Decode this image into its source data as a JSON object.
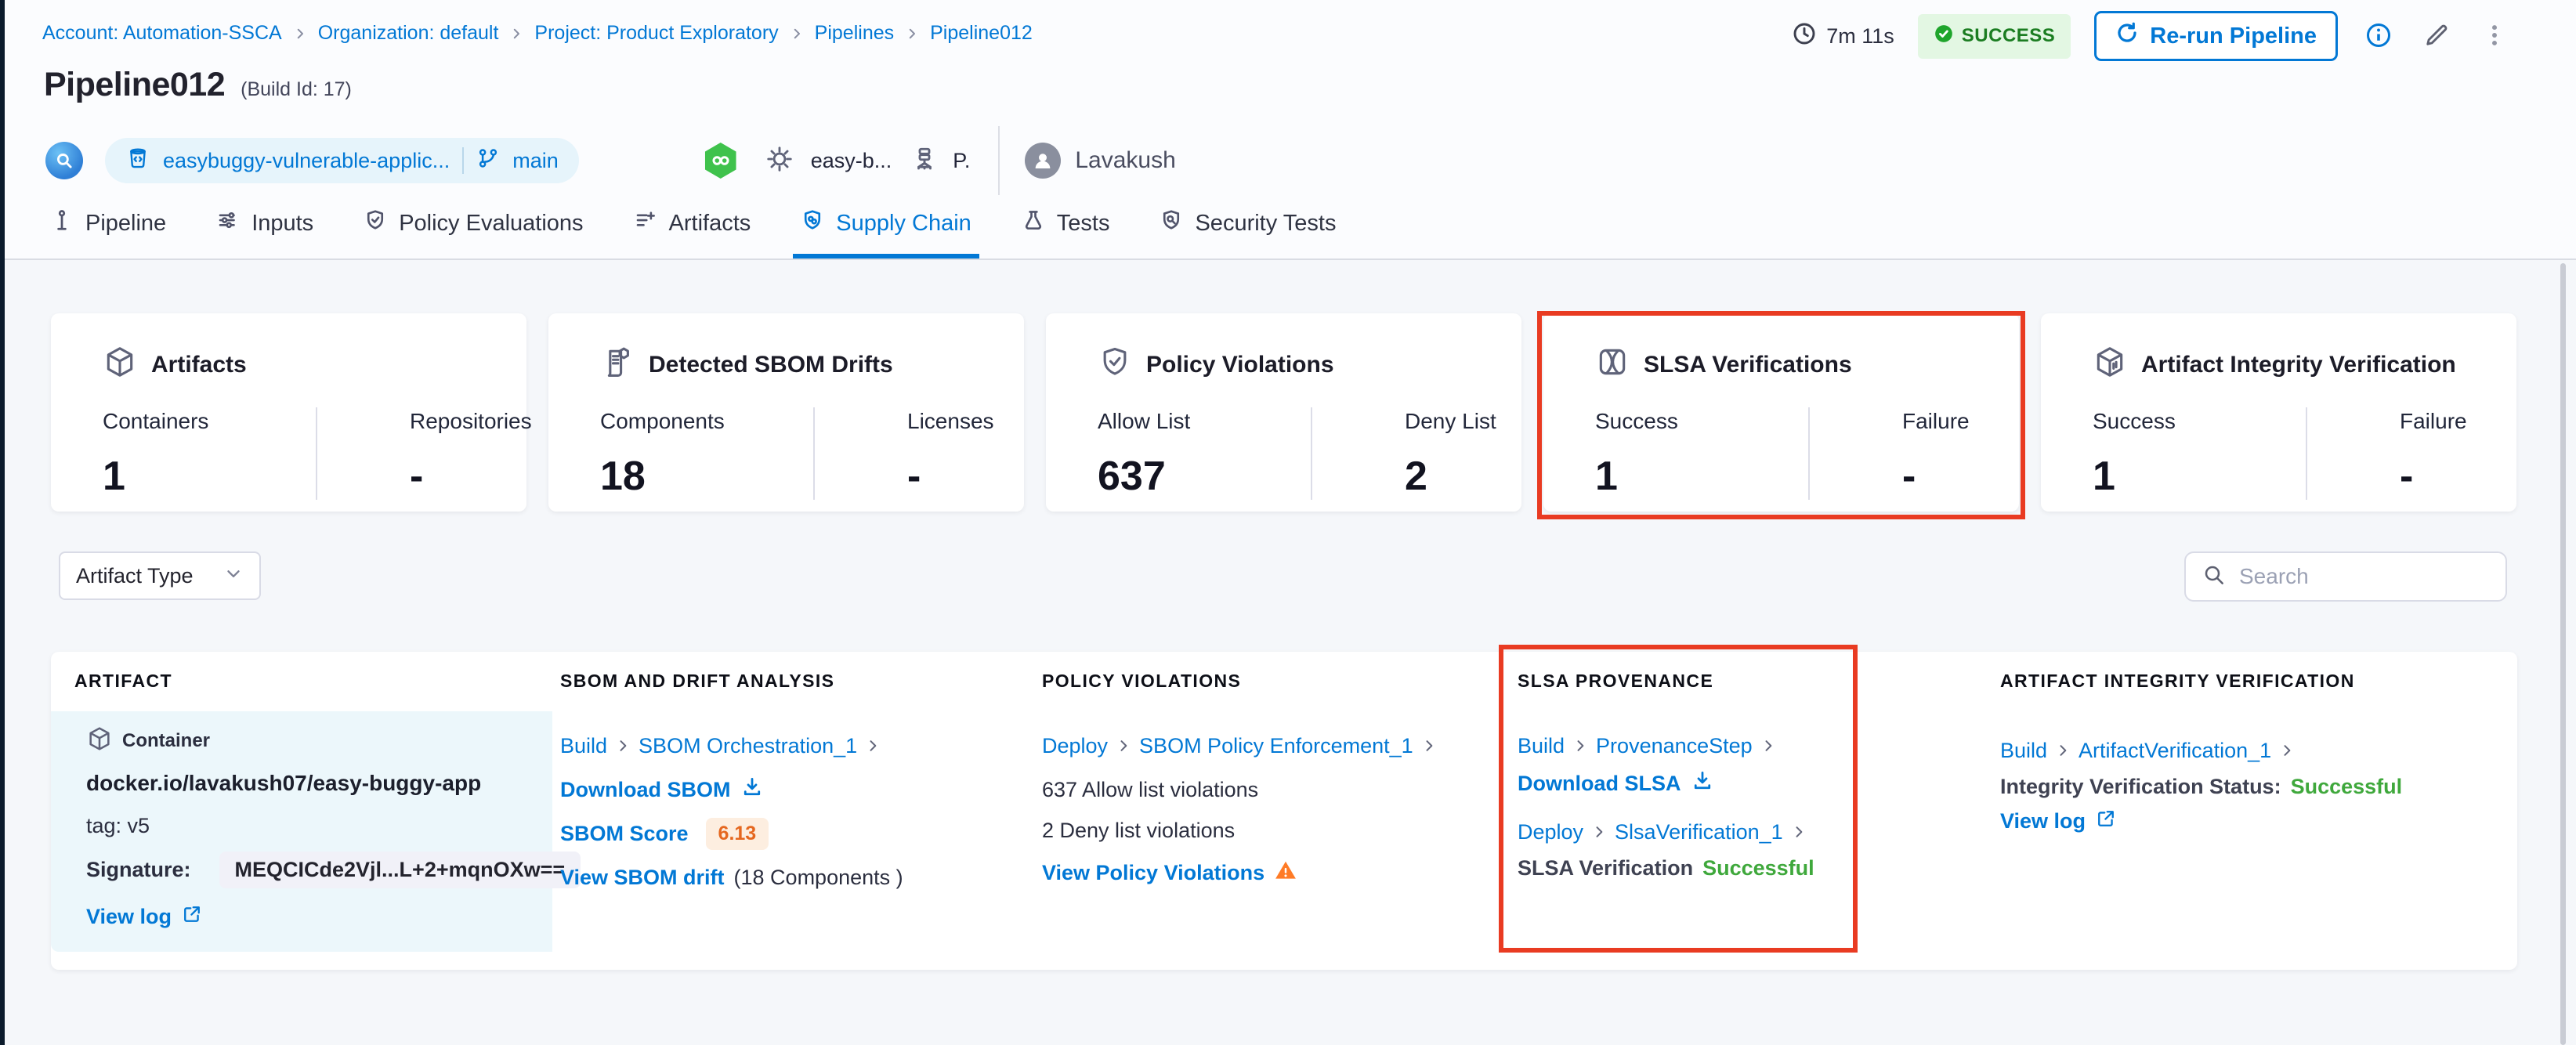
{
  "breadcrumb": {
    "items": [
      "Account: Automation-SSCA",
      "Organization: default",
      "Project: Product Exploratory",
      "Pipelines",
      "Pipeline012"
    ]
  },
  "run_meta": {
    "duration": "7m 11s",
    "status": "SUCCESS",
    "rerun_label": "Re-run Pipeline"
  },
  "header": {
    "title": "Pipeline012",
    "build_id": "(Build Id: 17)",
    "repo_name": "easybuggy-vulnerable-applic...",
    "branch": "main",
    "trigger_label": "easy-b...",
    "trigger_abbrev": "P.",
    "user": "Lavakush"
  },
  "tabs": [
    {
      "label": "Pipeline",
      "icon": "pipeline-icon"
    },
    {
      "label": "Inputs",
      "icon": "inputs-icon"
    },
    {
      "label": "Policy Evaluations",
      "icon": "shield-check-icon"
    },
    {
      "label": "Artifacts",
      "icon": "list-plus-icon"
    },
    {
      "label": "Supply Chain",
      "icon": "shield-link-icon",
      "active": true
    },
    {
      "label": "Tests",
      "icon": "flask-icon"
    },
    {
      "label": "Security Tests",
      "icon": "shield-search-icon"
    }
  ],
  "summary_cards": [
    {
      "title": "Artifacts",
      "icon": "cube-icon",
      "stats": [
        {
          "label": "Containers",
          "value": "1"
        },
        {
          "label": "Repositories",
          "value": "-"
        }
      ]
    },
    {
      "title": "Detected SBOM Drifts",
      "icon": "sbom-document-icon",
      "stats": [
        {
          "label": "Components",
          "value": "18"
        },
        {
          "label": "Licenses",
          "value": "-"
        }
      ]
    },
    {
      "title": "Policy Violations",
      "icon": "shield-check-icon",
      "stats": [
        {
          "label": "Allow List",
          "value": "637"
        },
        {
          "label": "Deny List",
          "value": "2"
        }
      ]
    },
    {
      "title": "SLSA Verifications",
      "icon": "slsa-badge-icon",
      "highlighted": true,
      "stats": [
        {
          "label": "Success",
          "value": "1"
        },
        {
          "label": "Failure",
          "value": "-"
        }
      ]
    },
    {
      "title": "Artifact Integrity Verification",
      "icon": "integrity-cube-icon",
      "stats": [
        {
          "label": "Success",
          "value": "1"
        },
        {
          "label": "Failure",
          "value": "-"
        }
      ]
    }
  ],
  "filters": {
    "artifact_type_label": "Artifact Type",
    "search_placeholder": "Search"
  },
  "table": {
    "columns": [
      "ARTIFACT",
      "SBOM AND DRIFT ANALYSIS",
      "POLICY VIOLATIONS",
      "SLSA PROVENANCE",
      "ARTIFACT INTEGRITY VERIFICATION"
    ],
    "row": {
      "artifact": {
        "type_label": "Container",
        "name": "docker.io/lavakush07/easy-buggy-app",
        "tag": "tag: v5",
        "signature_label": "Signature:",
        "signature_value": "MEQCICde2Vjl...L+2+mqnOXw==",
        "view_log": "View log"
      },
      "sbom": {
        "stage": "Build",
        "step": "SBOM Orchestration_1",
        "download": "Download SBOM",
        "score_label": "SBOM Score",
        "score": "6.13",
        "drift_link": "View SBOM drift",
        "drift_note": "(18 Components )"
      },
      "policy": {
        "stage": "Deploy",
        "step": "SBOM Policy Enforcement_1",
        "allow": "637 Allow list violations",
        "deny": "2 Deny list violations",
        "view": "View Policy Violations"
      },
      "slsa": {
        "stage1": "Build",
        "step1": "ProvenanceStep",
        "download": "Download SLSA",
        "stage2": "Deploy",
        "step2": "SlsaVerification_1",
        "status_label": "SLSA Verification",
        "status": "Successful"
      },
      "integrity": {
        "stage": "Build",
        "step": "ArtifactVerification_1",
        "status_label": "Integrity Verification Status:",
        "status": "Successful",
        "view_log": "View log"
      }
    }
  },
  "colors": {
    "accent_blue": "#0278D5",
    "success_green": "#3FA83C",
    "success_badge_bg": "#E3F7E3",
    "success_badge_text": "#1B7D21",
    "highlight_red": "#E93B22",
    "warning_orange": "#FF7B26",
    "score_orange": "#E5671F"
  }
}
